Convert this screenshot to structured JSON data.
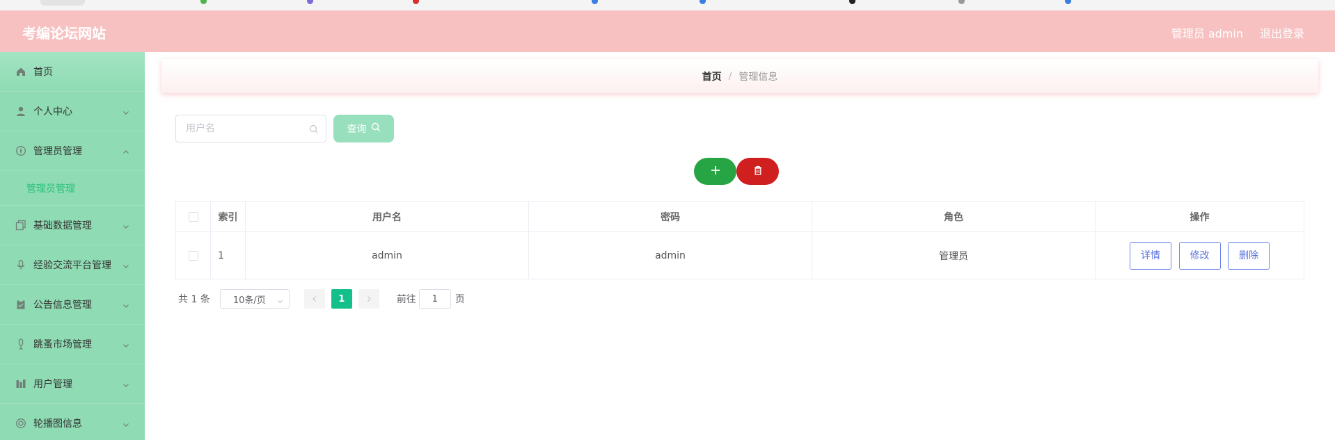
{
  "header": {
    "site_title": "考编论坛网站",
    "user_label": "管理员 admin",
    "logout_label": "退出登录",
    "background": "#f7c1c1"
  },
  "sidebar": {
    "background": "#8fdbb3",
    "items": [
      {
        "label": "首页",
        "icon": "home-icon"
      },
      {
        "label": "个人中心",
        "icon": "user-icon"
      },
      {
        "label": "管理员管理",
        "icon": "compass-icon",
        "expanded": true,
        "children": [
          {
            "label": "管理员管理",
            "active": true
          }
        ]
      },
      {
        "label": "基础数据管理",
        "icon": "copy-icon"
      },
      {
        "label": "经验交流平台管理",
        "icon": "microphone-icon"
      },
      {
        "label": "公告信息管理",
        "icon": "clipboard-icon"
      },
      {
        "label": "跳蚤市场管理",
        "icon": "mic-stand-icon"
      },
      {
        "label": "用户管理",
        "icon": "chart-icon"
      },
      {
        "label": "轮播图信息",
        "icon": "life-ring-icon"
      }
    ]
  },
  "breadcrumb": {
    "home": "首页",
    "separator": "/",
    "current": "管理信息"
  },
  "search": {
    "placeholder": "用户名",
    "value": "",
    "query_label": "查询"
  },
  "table": {
    "columns": [
      "索引",
      "用户名",
      "密码",
      "角色",
      "操作"
    ],
    "rows": [
      {
        "index": "1",
        "username": "admin",
        "password": "admin",
        "role": "管理员"
      }
    ],
    "actions": [
      "详情",
      "修改",
      "删除"
    ]
  },
  "pagination": {
    "total": "共 1 条",
    "page_size": "10条/页",
    "current_page": "1",
    "goto_prefix": "前往",
    "goto_value": "1",
    "goto_suffix": "页"
  },
  "colors": {
    "accent_green": "#13c08a",
    "add_button": "#27a444",
    "delete_button": "#cf1f1f",
    "action_border": "#6f86e8"
  }
}
